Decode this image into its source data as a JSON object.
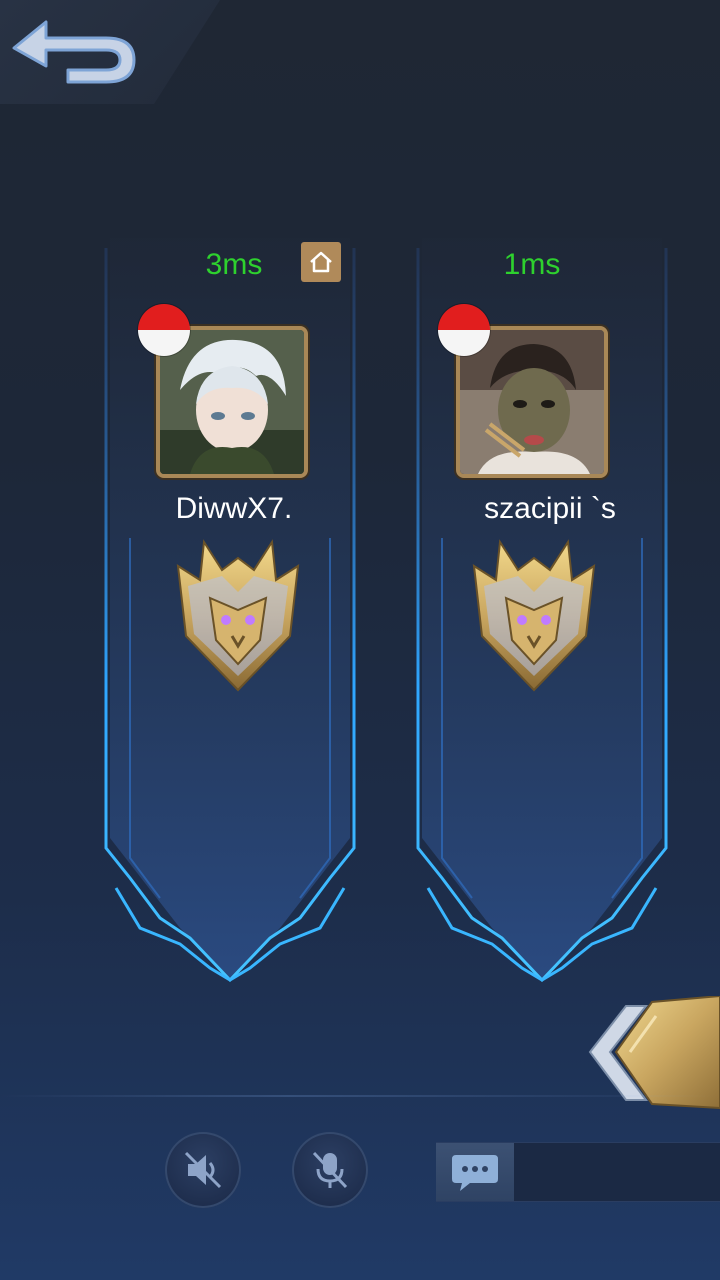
{
  "players": [
    {
      "name": "DiwwX7.",
      "ping": "3ms",
      "is_host": true,
      "flag": "indonesia-flag-icon",
      "avatar": "white-haired-anime-character",
      "rank": "mythic-rank-emblem"
    },
    {
      "name": "szacipii `s",
      "ping": "1ms",
      "is_host": false,
      "flag": "indonesia-flag-icon",
      "avatar": "person-with-face-mask",
      "rank": "mythic-rank-emblem"
    }
  ],
  "icons": {
    "back": "back-arrow-icon",
    "home": "home-icon",
    "speaker": "speaker-muted-icon",
    "mic": "mic-muted-icon",
    "chat": "chat-bubble-icon",
    "next": "gold-arrow-icon"
  },
  "colors": {
    "ping": "#2ed12e",
    "frame_glow": "#2fa6ff",
    "gold": "#c9a660",
    "flag_red": "#e11e1e",
    "flag_white": "#f5f5f5"
  }
}
